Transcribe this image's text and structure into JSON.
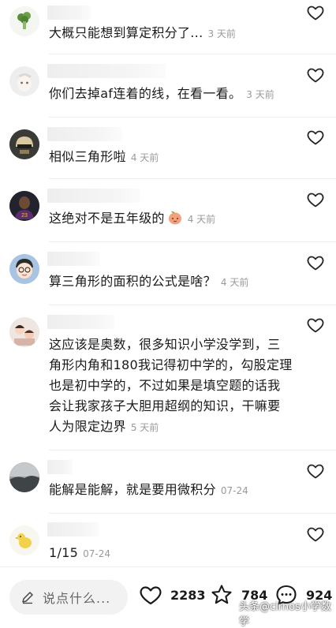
{
  "comments": [
    {
      "text": "大概只能想到算定积分了...",
      "time": "3 天前"
    },
    {
      "text": "你们去掉af连着的线，在看一看。",
      "time": "3 天前"
    },
    {
      "text": "相似三角形啦",
      "time": "4 天前"
    },
    {
      "text": "这绝对不是五年级的",
      "time": "4 天前"
    },
    {
      "text": "算三角形的面积的公式是啥？",
      "time": "4 天前"
    },
    {
      "lines": [
        "这应该是奥数，很多知识小学没学到，三",
        "角形内角和180我记得初中学的，勾股定理",
        "也是初中学的，不过如果是填空题的话我",
        "会让我家孩子大胆用超纲的知识，干嘛要"
      ],
      "last_line": "人为限定边界",
      "time": "5 天前"
    },
    {
      "text": "能解是能解，就是要用微积分",
      "time": "07-24"
    },
    {
      "text": "1/15",
      "time": "07-24"
    }
  ],
  "icons": {
    "like": "heart-outline-icon",
    "input": "pencil-icon",
    "star": "star-outline-icon",
    "comment": "chat-bubble-icon"
  },
  "bottom_bar": {
    "input_placeholder": "说点什么...",
    "like_count": "2283",
    "star_count": "784",
    "comment_count": "924"
  },
  "watermark": "头条@cirnos小学数学"
}
